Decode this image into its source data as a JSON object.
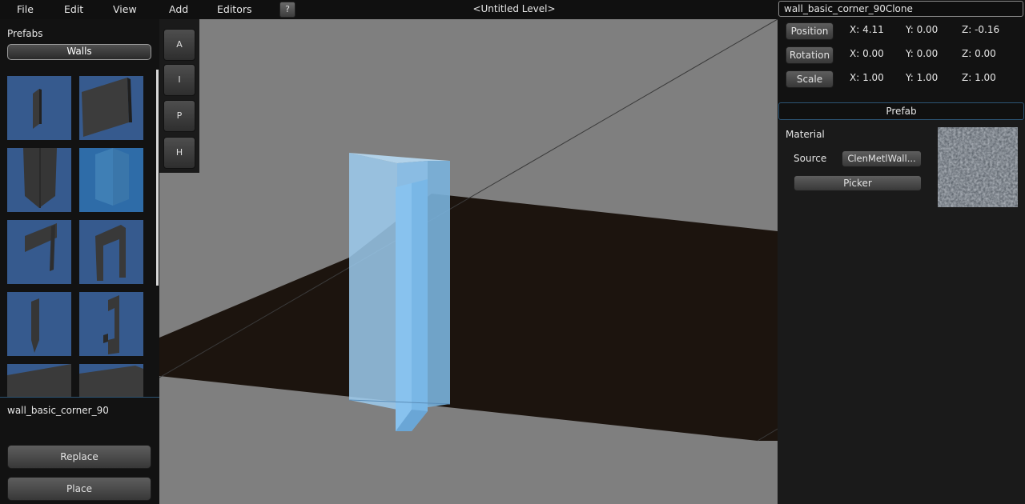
{
  "menu": {
    "items": [
      "File",
      "Edit",
      "View",
      "Add",
      "Editors"
    ],
    "help_label": "?"
  },
  "level_title": "<Untitled Level>",
  "left_panel": {
    "prefabs_label": "Prefabs",
    "category_button": "Walls",
    "selected_prefab": "wall_basic_corner_90",
    "replace_label": "Replace",
    "place_label": "Place"
  },
  "tools": [
    "A",
    "I",
    "P",
    "H"
  ],
  "inspector": {
    "object_name": "wall_basic_corner_90Clone",
    "position": {
      "label": "Position",
      "x": "X: 4.11",
      "y": "Y: 0.00",
      "z": "Z: -0.16"
    },
    "rotation": {
      "label": "Rotation",
      "x": "X: 0.00",
      "y": "Y: 0.00",
      "z": "Z: 0.00"
    },
    "scale": {
      "label": "Scale",
      "x": "X: 1.00",
      "y": "Y: 1.00",
      "z": "Z: 1.00"
    },
    "prefab_header": "Prefab",
    "material_label": "Material",
    "source_label": "Source",
    "source_value": "ClenMetlWall...",
    "picker_label": "Picker"
  },
  "colors": {
    "thumb_bg": "#365a8e",
    "selection_blue": "#8fc6f0",
    "floor": "#1c140e",
    "ground": "#7f7f7f"
  }
}
